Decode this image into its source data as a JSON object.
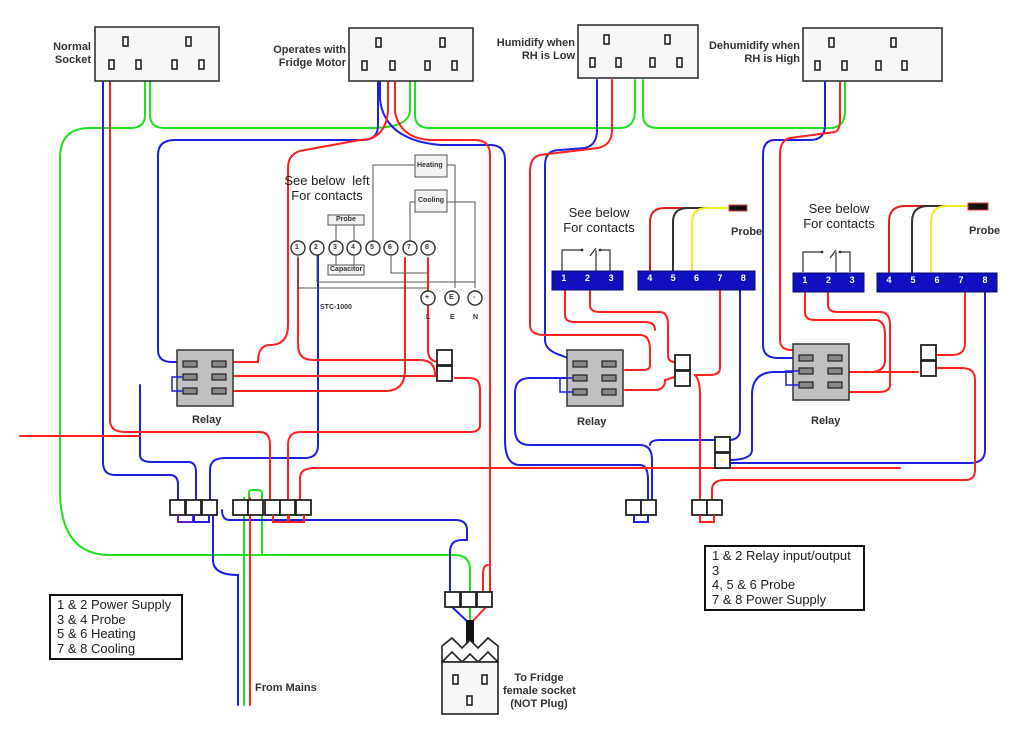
{
  "sockets": {
    "normal": "Normal\nSocket",
    "fridge_motor": "Operates with\nFridge Motor",
    "humidify": "Humidify when\nRH is Low",
    "dehumidify": "Dehumidify when\nRH is High"
  },
  "notes": {
    "stc_contacts": "See below  left\nFor contacts",
    "humid_contacts": "See below\nFor contacts",
    "dehumid_contacts": "See below\nFor contacts"
  },
  "stc1000": {
    "model": "STC-1000",
    "terminals": [
      "1",
      "2",
      "3",
      "4",
      "5",
      "6",
      "7",
      "8"
    ],
    "probe_label": "Probe",
    "capacitor_label": "Capacitor",
    "heating_label": "Heating",
    "cooling_label": "Cooling",
    "power_terminals": [
      "+",
      "E",
      "-"
    ],
    "power_labels": [
      "L",
      "E",
      "N"
    ]
  },
  "controllers": {
    "terminals_left": [
      "1",
      "2",
      "3"
    ],
    "terminals_right": [
      "4",
      "5",
      "6",
      "7",
      "8"
    ],
    "probe_label": "Probe"
  },
  "relays": {
    "label": "Relay"
  },
  "legend_left": {
    "lines": [
      "1 & 2 Power Supply",
      "3 & 4 Probe",
      "5 & 6 Heating",
      "7 & 8 Cooling"
    ]
  },
  "legend_right": {
    "lines": [
      "1 & 2 Relay input/output",
      "3",
      "4, 5 & 6 Probe",
      "7 & 8 Power Supply"
    ]
  },
  "mains_label": "From Mains",
  "fridge_socket_label": "To Fridge\nfemale socket\n(NOT Plug)",
  "colors": {
    "live": "#ff2020",
    "neutral": "#2020e0",
    "earth": "#20e020",
    "terminal_block": "#1010c0",
    "relay_body": "#c0c0c0",
    "probe_yellow": "#f0f020"
  }
}
